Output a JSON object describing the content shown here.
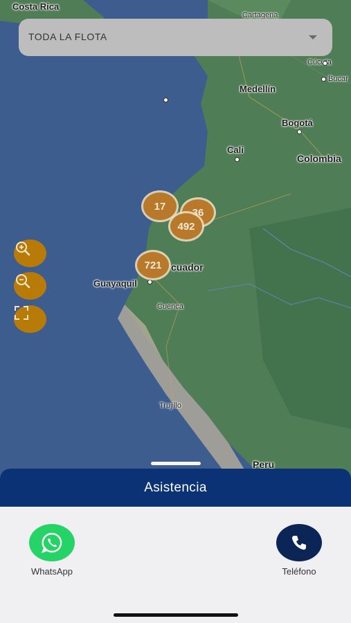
{
  "fleet_select": {
    "value": "TODA LA FLOTA"
  },
  "map": {
    "labels": {
      "costa_rica": "Costa Rica",
      "cartagena": "Cartagena",
      "cucuta": "Cúcuta",
      "bucaramanga": "Bucar",
      "medellin": "Medellín",
      "bogota": "Bogotá",
      "cali": "Cali",
      "colombia": "Colombia",
      "ecuador": "cuador",
      "guayaquil": "Guayaquil",
      "cuenca": "Cuenca",
      "trujillo": "Trujillo",
      "peru": "Peru"
    },
    "clusters": [
      {
        "id": "c17",
        "count": "17"
      },
      {
        "id": "c36",
        "count": "36"
      },
      {
        "id": "c492",
        "count": "492"
      },
      {
        "id": "c721",
        "count": "721"
      }
    ],
    "colors": {
      "cluster": "#b8792a",
      "control": "#b97b08",
      "ocean": "#3d5d8f",
      "land": "#4f7d55"
    }
  },
  "controls": {
    "zoom_in": "zoom-in-icon",
    "zoom_out": "zoom-out-icon",
    "fit": "fullscreen-icon"
  },
  "assistance": {
    "title": "Asistencia",
    "whatsapp_label": "WhatsApp",
    "phone_label": "Teléfono",
    "colors": {
      "header": "#0a3274",
      "whatsapp": "#25d366",
      "phone": "#0a2556"
    }
  }
}
